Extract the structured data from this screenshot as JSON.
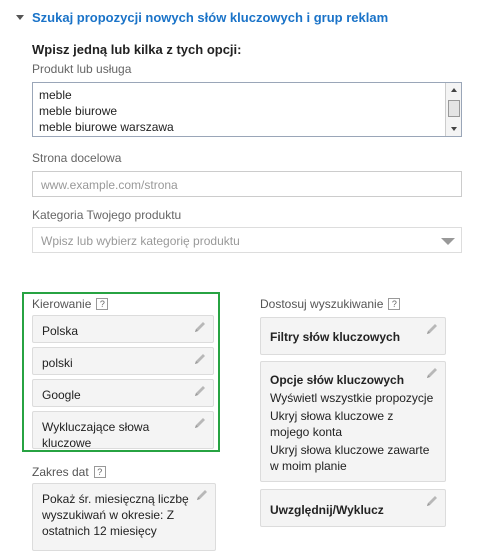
{
  "header": {
    "title": "Szukaj propozycji nowych słów kluczowych i grup reklam"
  },
  "instruction": "Wpisz jedną lub kilka z tych opcji:",
  "product": {
    "label": "Produkt lub usługa",
    "items": [
      "meble",
      "meble biurowe",
      "meble biurowe warszawa"
    ]
  },
  "landing": {
    "label": "Strona docelowa",
    "placeholder": "www.example.com/strona"
  },
  "category": {
    "label": "Kategoria Twojego produktu",
    "placeholder": "Wpisz lub wybierz kategorię produktu"
  },
  "targeting": {
    "label": "Kierowanie",
    "help": "?",
    "items": [
      "Polska",
      "polski",
      "Google",
      "Wykluczające słowa kluczowe"
    ]
  },
  "date_range": {
    "label": "Zakres dat",
    "help": "?",
    "text": "Pokaż śr. miesięczną liczbę wyszukiwań w okresie: Z ostatnich 12 miesięcy"
  },
  "customize": {
    "label": "Dostosuj wyszukiwanie",
    "help": "?",
    "filters": "Filtry słów kluczowych",
    "options_title": "Opcje słów kluczowych",
    "options": [
      "Wyświetl wszystkie propozycje",
      "Ukryj słowa kluczowe z mojego konta",
      "Ukryj słowa kluczowe zawarte w moim planie"
    ],
    "include_exclude": "Uwzględnij/Wyklucz"
  },
  "colors": {
    "accent": "#1a73c8",
    "highlight_border": "#27a342"
  }
}
